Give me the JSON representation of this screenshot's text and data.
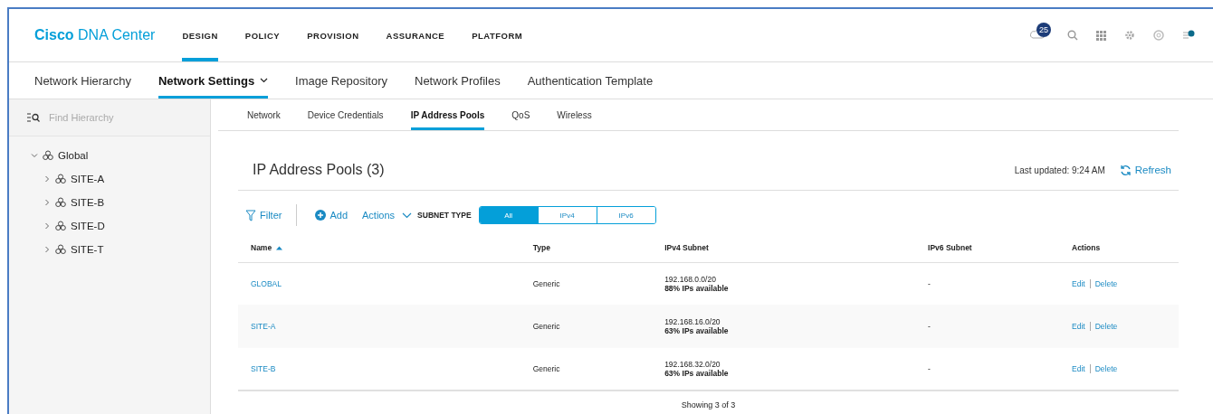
{
  "brand": {
    "bold": "Cisco",
    "rest": "DNA Center"
  },
  "main_nav": [
    {
      "label": "DESIGN",
      "selected": true
    },
    {
      "label": "POLICY",
      "selected": false
    },
    {
      "label": "PROVISION",
      "selected": false
    },
    {
      "label": "ASSURANCE",
      "selected": false
    },
    {
      "label": "PLATFORM",
      "selected": false
    }
  ],
  "notification_badge": "25",
  "sub_nav": [
    {
      "label": "Network Hierarchy",
      "selected": false
    },
    {
      "label": "Network Settings",
      "selected": true,
      "dropdown": true
    },
    {
      "label": "Image Repository",
      "selected": false
    },
    {
      "label": "Network Profiles",
      "selected": false
    },
    {
      "label": "Authentication Template",
      "selected": false
    }
  ],
  "sidebar": {
    "search": {
      "placeholder": "Find Hierarchy"
    },
    "tree": [
      {
        "label": "Global",
        "expanded": true,
        "children": [
          {
            "label": "SITE-A",
            "expanded": false
          },
          {
            "label": "SITE-B",
            "expanded": false
          },
          {
            "label": "SITE-D",
            "expanded": false
          },
          {
            "label": "SITE-T",
            "expanded": false
          }
        ]
      }
    ]
  },
  "tabs": [
    {
      "label": "Network",
      "selected": false
    },
    {
      "label": "Device Credentials",
      "selected": false
    },
    {
      "label": "IP Address Pools",
      "selected": true
    },
    {
      "label": "QoS",
      "selected": false
    },
    {
      "label": "Wireless",
      "selected": false
    }
  ],
  "panel": {
    "title": "IP Address Pools (3)",
    "last_updated": "Last updated: 9:24 AM",
    "refresh": "Refresh"
  },
  "toolbar": {
    "filter": "Filter",
    "add": "Add",
    "actions": "Actions",
    "subnet_type_label": "SUBNET TYPE",
    "subnet_types": [
      {
        "label": "All",
        "selected": true
      },
      {
        "label": "IPv4",
        "selected": false
      },
      {
        "label": "IPv6",
        "selected": false
      }
    ]
  },
  "table": {
    "columns": [
      "Name",
      "Type",
      "IPv4 Subnet",
      "IPv6 Subnet",
      "Actions"
    ],
    "rows": [
      {
        "name": "GLOBAL",
        "type": "Generic",
        "ipv4_subnet": "192.168.0.0/20",
        "ipv4_available": "88% IPs available",
        "ipv6_subnet": "-",
        "actions": [
          "Edit",
          "Delete"
        ]
      },
      {
        "name": "SITE-A",
        "type": "Generic",
        "ipv4_subnet": "192.168.16.0/20",
        "ipv4_available": "63% IPs available",
        "ipv6_subnet": "-",
        "actions": [
          "Edit",
          "Delete"
        ]
      },
      {
        "name": "SITE-B",
        "type": "Generic",
        "ipv4_subnet": "192.168.32.0/20",
        "ipv4_available": "63% IPs available",
        "ipv6_subnet": "-",
        "actions": [
          "Edit",
          "Delete"
        ]
      }
    ],
    "footer": "Showing 3 of 3"
  }
}
